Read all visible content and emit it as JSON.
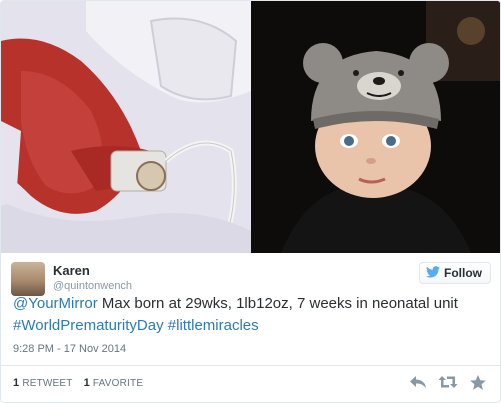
{
  "media": {
    "left_photo": "premature-baby-in-incubator",
    "right_photo": "toddler-in-knitted-bear-hat"
  },
  "author": {
    "name": "Karen",
    "handle": "@quintonwench"
  },
  "follow": {
    "label": "Follow",
    "icon": "twitter-bird-icon"
  },
  "tweet": {
    "mention": "@YourMirror",
    "body": " Max born at 29wks, 1lb12oz, 7 weeks in neonatal unit",
    "hashtag1": "#WorldPrematurityDay",
    "hashtag2": "#littlemiracles"
  },
  "timestamp": "9:28 PM - 17 Nov 2014",
  "stats": {
    "retweets_count": "1",
    "retweets_label": "RETWEET",
    "favorites_count": "1",
    "favorites_label": "FAVORITE"
  },
  "actions": [
    "reply-icon",
    "retweet-icon",
    "favorite-star-icon"
  ],
  "colors": {
    "link": "#2b7bb9",
    "meta": "#66757f",
    "twitter_blue": "#55acee"
  }
}
